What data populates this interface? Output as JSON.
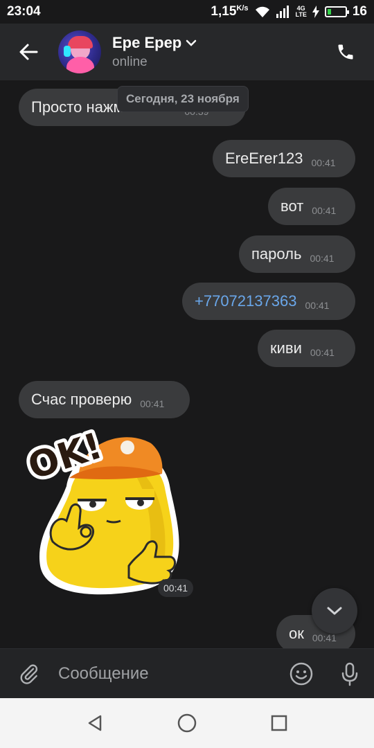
{
  "status_bar": {
    "time": "23:04",
    "speed_value": "1,15",
    "speed_unit": "K/s",
    "network": "4G\nLTE",
    "battery_level": "16"
  },
  "header": {
    "name": "Ере Ерер",
    "status": "online"
  },
  "chat": {
    "date_label": "Сегодня, 23 ноября",
    "messages": [
      {
        "text": "Просто нажми засвй",
        "time": "00:39",
        "direction": "incoming"
      },
      {
        "text": "EreErer123",
        "time": "00:41",
        "direction": "outgoing"
      },
      {
        "text": "вот",
        "time": "00:41",
        "direction": "outgoing"
      },
      {
        "text": "пароль",
        "time": "00:41",
        "direction": "outgoing"
      },
      {
        "text": "+77072137363",
        "time": "00:41",
        "direction": "outgoing"
      },
      {
        "text": "киви",
        "time": "00:41",
        "direction": "outgoing"
      },
      {
        "text": "Счас проверю",
        "time": "00:41",
        "direction": "incoming"
      },
      {
        "text": "ок",
        "time": "00:41",
        "direction": "outgoing"
      }
    ],
    "sticker": {
      "label": "OK!",
      "time": "00:41"
    }
  },
  "input": {
    "placeholder": "Сообщение"
  },
  "colors": {
    "background": "#19191a",
    "bubble": "#3a3b3d",
    "header": "#27282a",
    "link": "#6aa7ea",
    "battery": "#35d34a"
  }
}
